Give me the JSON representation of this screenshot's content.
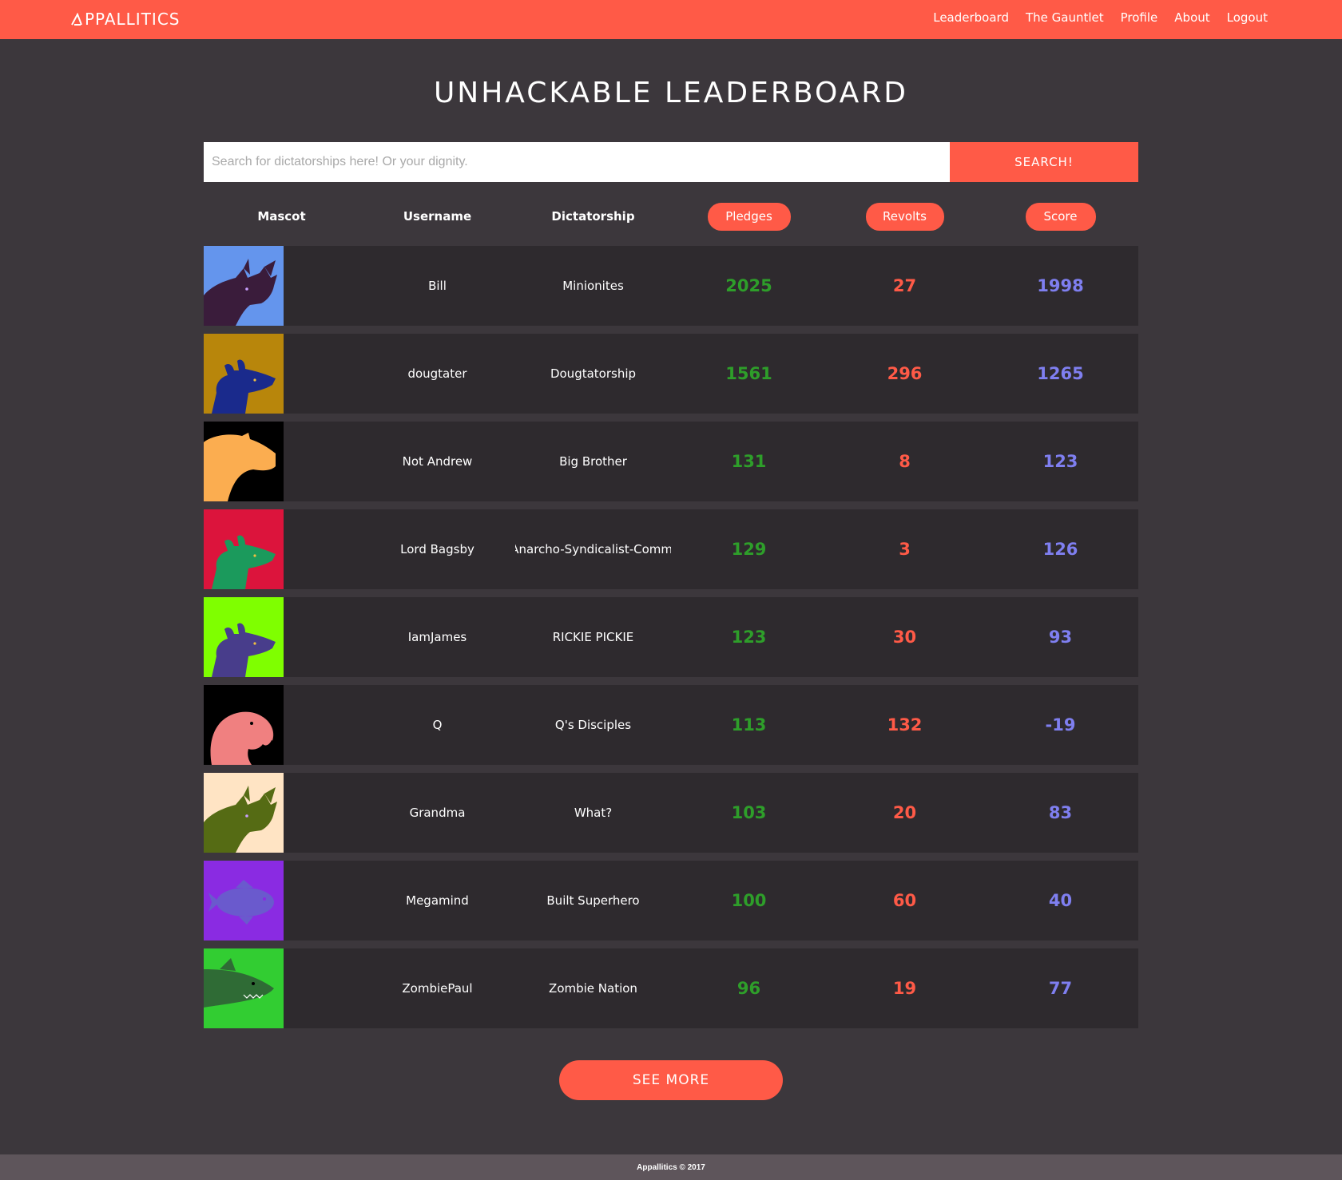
{
  "brand": {
    "name": "PPALLITICS"
  },
  "nav": {
    "items": [
      "Leaderboard",
      "The Gauntlet",
      "Profile",
      "About",
      "Logout"
    ]
  },
  "title": "UNHACKABLE LEADERBOARD",
  "search": {
    "placeholder": "Search for dictatorships here! Or your dignity.",
    "value": "",
    "button": "SEARCH!"
  },
  "columns": {
    "mascot": "Mascot",
    "username": "Username",
    "dictatorship": "Dictatorship",
    "pledges": "Pledges",
    "revolts": "Revolts",
    "score": "Score"
  },
  "rows": [
    {
      "mascot": "rhino",
      "bg": "#6495ed",
      "fg": "#3a1c3b",
      "username": "Bill",
      "dictatorship": "Minionites",
      "pledges": "2025",
      "revolts": "27",
      "score": "1998"
    },
    {
      "mascot": "rat",
      "bg": "#b8860b",
      "fg": "#1a2a8c",
      "username": "dougtater",
      "dictatorship": "Dougtatorship",
      "pledges": "1561",
      "revolts": "296",
      "score": "1265"
    },
    {
      "mascot": "capybara",
      "bg": "#000000",
      "fg": "#fbad50",
      "username": "Not Andrew",
      "dictatorship": "Big Brother",
      "pledges": "131",
      "revolts": "8",
      "score": "123"
    },
    {
      "mascot": "rat",
      "bg": "#dc143c",
      "fg": "#1b9a5c",
      "username": "Lord Bagsby",
      "dictatorship": "An Anarcho-Syndicalist-Commune",
      "pledges": "129",
      "revolts": "3",
      "score": "126"
    },
    {
      "mascot": "rat",
      "bg": "#7fff00",
      "fg": "#483d8b",
      "username": "IamJames",
      "dictatorship": "RICKIE PICKIE",
      "pledges": "123",
      "revolts": "30",
      "score": "93"
    },
    {
      "mascot": "parrot",
      "bg": "#000000",
      "fg": "#f08080",
      "username": "Q",
      "dictatorship": "Q's Disciples",
      "pledges": "113",
      "revolts": "132",
      "score": "-19"
    },
    {
      "mascot": "rhino",
      "bg": "#ffe4c4",
      "fg": "#556b14",
      "username": "Grandma",
      "dictatorship": "What?",
      "pledges": "103",
      "revolts": "20",
      "score": "83"
    },
    {
      "mascot": "fish",
      "bg": "#8a2be2",
      "fg": "#6a5acd",
      "username": "Megamind",
      "dictatorship": "Built Superhero",
      "pledges": "100",
      "revolts": "60",
      "score": "40"
    },
    {
      "mascot": "shark",
      "bg": "#32cd32",
      "fg": "#2f6b35",
      "username": "ZombiePaul",
      "dictatorship": "Zombie Nation",
      "pledges": "96",
      "revolts": "19",
      "score": "77"
    }
  ],
  "see_more": "SEE MORE",
  "footer": "Appallitics © 2017"
}
